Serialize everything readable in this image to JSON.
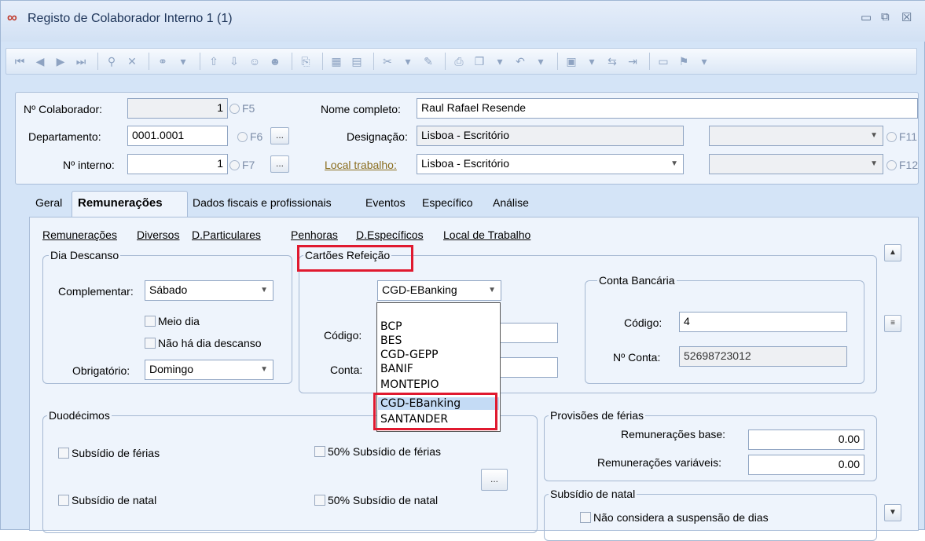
{
  "window": {
    "title": "Registo de Colaborador Interno 1 (1)",
    "controls": [
      "▭",
      "⧉",
      "☒"
    ]
  },
  "toolbar": {
    "icons": [
      "first-record-icon",
      "prev-record-icon",
      "next-record-icon",
      "last-record-icon",
      "binoculars-icon",
      "clear-filter-icon",
      "find-icon",
      "find-dropdown-icon",
      "move-up-icon",
      "move-down-icon",
      "user-icon",
      "user-add-icon",
      "export-icon",
      "calendar-icon",
      "chart-icon",
      "tools-icon",
      "tools-dropdown-icon",
      "edit-icon",
      "print-icon",
      "copy-icon",
      "copy-dropdown-icon",
      "undo-icon",
      "undo-dropdown-icon",
      "window-icon",
      "window-dropdown-icon",
      "link-icon",
      "arrow-icon",
      "layout-icon",
      "user-card-icon",
      "flag-icon",
      "flag-dropdown-icon"
    ]
  },
  "header": {
    "colaborador_label": "Nº Colaborador:",
    "colaborador_value": "1",
    "f5": "F5",
    "nome_label": "Nome completo:",
    "nome_value": "Raul Rafael Resende",
    "departamento_label": "Departamento:",
    "departamento_value": "0001.0001",
    "f6": "F6",
    "ellipsis": "...",
    "designacao_label": "Designação:",
    "designacao_value": "Lisboa - Escritório",
    "f11": "F11",
    "interno_label": "Nº interno:",
    "interno_value": "1",
    "f7": "F7",
    "local_label": "Local trabalho:",
    "local_value": "Lisboa - Escritório",
    "f12": "F12"
  },
  "tabs": {
    "geral": "Geral",
    "remuneracoes": "Remunerações",
    "dados": "Dados fiscais e profissionais",
    "eventos": "Eventos",
    "especifico": "Específico",
    "analise": "Análise"
  },
  "sublinks": [
    "Remunerações",
    "Diversos",
    "D.Particulares",
    "Penhoras",
    "D.Específicos",
    "Local de Trabalho"
  ],
  "dia_descanso": {
    "title": "Dia Descanso",
    "complementar_label": "Complementar:",
    "complementar_value": "Sábado",
    "meio_dia": "Meio dia",
    "nao_ha": "Não há dia descanso",
    "obrigatorio_label": "Obrigatório:",
    "obrigatorio_value": "Domingo"
  },
  "cartoes": {
    "title": "Cartões Refeição",
    "selected": "CGD-EBanking",
    "codigo_label": "Código:",
    "conta_label": "Conta:",
    "options": [
      "BCP",
      "BES",
      "CGD-GEPP",
      "BANIF",
      "MONTEPIO",
      "CGD-EBanking",
      "SANTANDER"
    ]
  },
  "conta_bancaria": {
    "title": "Conta Bancária",
    "codigo_label": "Código:",
    "codigo_value": "4",
    "conta_label": "Nº Conta:",
    "conta_value": "52698723012"
  },
  "duodecimos": {
    "title": "Duodécimos",
    "sub_ferias": "Subsídio de férias",
    "sub_ferias_50": "50% Subsídio de férias",
    "sub_natal": "Subsídio de natal",
    "sub_natal_50": "50% Subsídio de natal",
    "ellipsis": "..."
  },
  "provisoes": {
    "title": "Provisões de férias",
    "base_label": "Remunerações base:",
    "base_value": "0.00",
    "variaveis_label": "Remunerações variáveis:",
    "variaveis_value": "0.00"
  },
  "subsidio_natal": {
    "title": "Subsídio de natal",
    "nao_considera": "Não considera a suspensão de dias"
  },
  "scroll": {
    "up": "▲",
    "thumb": "≡",
    "down": "▼"
  }
}
